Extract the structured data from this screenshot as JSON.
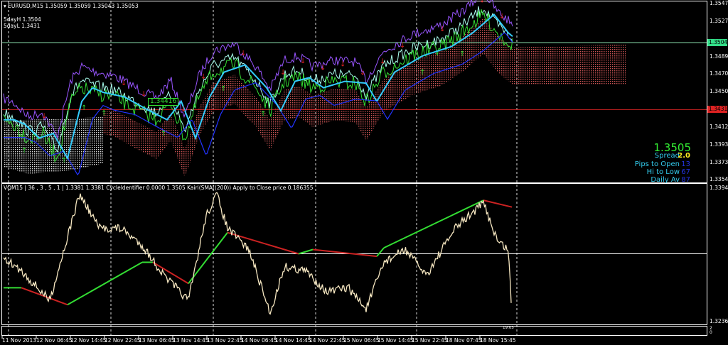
{
  "header": {
    "symbol_line": "EURUSD,M15  1.35059 1.35059 1.35043 1.35053",
    "five_day_high": "5dayH 1.3504",
    "five_day_low": "5dayL 1.3431"
  },
  "indicator_line": "VQM15 | 36 , 3 , 5 , 1 |  1.3381 1.3381  CycleIdentifier 0.0000 1.3505  Kairi(SMA((200)) Apply to Close price 0.186355",
  "price_label": "1.34416",
  "info_panel": {
    "price": "1.3505",
    "spread_label": "Spread",
    "spread": "2.0",
    "pips_open_label": "Pips to Open",
    "pips_open": "13",
    "hi_low_label": "Hi to Low",
    "hi_low": "67",
    "daily_av_label": "Daily Av",
    "daily_av": "87"
  },
  "main_axis": {
    "ticks": [
      "1.35470",
      "1.35275",
      "1.34890",
      "1.34700",
      "1.34505",
      "1.34120",
      "1.33930",
      "1.33735",
      "1.33546"
    ],
    "tick_values": [
      1.3547,
      1.35275,
      1.3489,
      1.347,
      1.34505,
      1.3412,
      1.3393,
      1.33735,
      1.33546
    ],
    "current_price": "1.35043",
    "current_value": 1.35043,
    "red_level": "1.34311",
    "red_value": 1.34311,
    "range": [
      1.33546,
      1.3547
    ]
  },
  "osc_axis": {
    "top": "1.3394",
    "bottom": "1.3236",
    "range": [
      1.3236,
      1.3394
    ],
    "mid": 1.3315
  },
  "sub_axis": {
    "top": "2",
    "bottom": "0"
  },
  "time_marker": "19:05",
  "time_labels": [
    "11 Nov 2013",
    "12 Nov 06:45",
    "12 Nov 14:45",
    "12 Nov 22:45",
    "13 Nov 06:45",
    "13 Nov 14:45",
    "13 Nov 22:45",
    "14 Nov 06:45",
    "14 Nov 14:45",
    "14 Nov 22:45",
    "15 Nov 06:45",
    "15 Nov 14:45",
    "15 Nov 22:45",
    "18 Nov 07:45",
    "18 Nov 15:45"
  ],
  "colors": {
    "bg": "#000000",
    "up": "#33dd33",
    "down": "#dd2222",
    "osc": "#f5e6c0",
    "cloud": "#cc4444",
    "purple": "#9955ff",
    "cyan": "#33ccff",
    "blue": "#2233ff"
  },
  "price_series": [
    [
      5,
      1.342
    ],
    [
      20,
      1.3415
    ],
    [
      40,
      1.34
    ],
    [
      60,
      1.3405
    ],
    [
      80,
      1.3378
    ],
    [
      100,
      1.344
    ],
    [
      115,
      1.3455
    ],
    [
      130,
      1.345
    ],
    [
      160,
      1.3445
    ],
    [
      190,
      1.3432
    ],
    [
      220,
      1.342
    ],
    [
      240,
      1.344
    ],
    [
      260,
      1.34
    ],
    [
      280,
      1.3445
    ],
    [
      300,
      1.3472
    ],
    [
      330,
      1.348
    ],
    [
      360,
      1.3455
    ],
    [
      380,
      1.343
    ],
    [
      400,
      1.3462
    ],
    [
      420,
      1.3466
    ],
    [
      440,
      1.3455
    ],
    [
      470,
      1.3462
    ],
    [
      500,
      1.346
    ],
    [
      515,
      1.344
    ],
    [
      540,
      1.3472
    ],
    [
      580,
      1.349
    ],
    [
      620,
      1.35
    ],
    [
      650,
      1.3515
    ],
    [
      680,
      1.3535
    ],
    [
      700,
      1.3515
    ],
    [
      720,
      1.3502
    ]
  ],
  "osc_series": [
    [
      5,
      1.331
    ],
    [
      30,
      1.3295
    ],
    [
      70,
      1.326
    ],
    [
      100,
      1.335
    ],
    [
      112,
      1.3385
    ],
    [
      140,
      1.3345
    ],
    [
      170,
      1.3345
    ],
    [
      200,
      1.3325
    ],
    [
      230,
      1.329
    ],
    [
      265,
      1.326
    ],
    [
      290,
      1.336
    ],
    [
      305,
      1.3385
    ],
    [
      320,
      1.3345
    ],
    [
      350,
      1.332
    ],
    [
      380,
      1.3245
    ],
    [
      400,
      1.33
    ],
    [
      430,
      1.3295
    ],
    [
      460,
      1.327
    ],
    [
      490,
      1.3275
    ],
    [
      515,
      1.325
    ],
    [
      540,
      1.3305
    ],
    [
      570,
      1.332
    ],
    [
      600,
      1.329
    ],
    [
      640,
      1.3345
    ],
    [
      680,
      1.3375
    ],
    [
      700,
      1.333
    ],
    [
      715,
      1.332
    ],
    [
      720,
      1.3245
    ]
  ],
  "signal_series": [
    [
      5,
      1.3275,
      "g"
    ],
    [
      30,
      1.3275,
      "r"
    ],
    [
      95,
      1.3255,
      "g"
    ],
    [
      200,
      1.3305,
      "g"
    ],
    [
      215,
      1.3305,
      "r"
    ],
    [
      265,
      1.328,
      "g"
    ],
    [
      320,
      1.334,
      "r"
    ],
    [
      420,
      1.3315,
      "g"
    ],
    [
      440,
      1.332,
      "r"
    ],
    [
      530,
      1.3312,
      "g"
    ],
    [
      540,
      1.3322,
      "g"
    ],
    [
      610,
      1.335,
      "g"
    ],
    [
      680,
      1.3378,
      "r"
    ],
    [
      720,
      1.337,
      "r"
    ]
  ]
}
